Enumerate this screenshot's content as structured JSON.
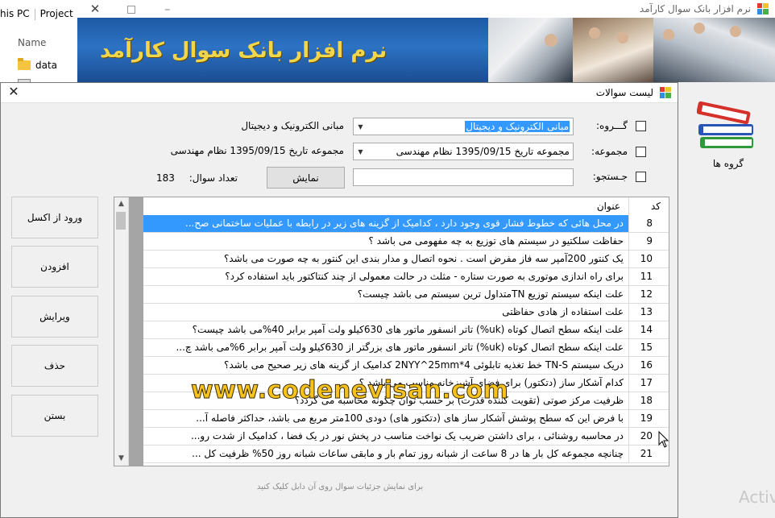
{
  "explorer": {
    "breadcrumb_1": "his PC",
    "breadcrumb_2": "Project",
    "column_name": "Name",
    "file_1": "data"
  },
  "main_window": {
    "title": "نرم افزار بانک سوال کارآمد",
    "banner_title": "نرم افزار بانک سوال کارآمد",
    "groups_label": "گروه ها",
    "activate_text": "Activ"
  },
  "dialog": {
    "title": "لیست سوالات",
    "group_label": "گـــروه:",
    "group_value": "مبانی الکترونیک و دیجیتال",
    "group_display": "مبانی الکترونیک و دیجیتال",
    "collection_label": "مجموعه:",
    "collection_value": "مجموعه تاریخ 1395/09/15 نظام مهندسی",
    "collection_display": "مجموعه تاریخ 1395/09/15 نظام مهندسی",
    "search_label": "جـستجو:",
    "search_value": "",
    "show_button": "نمایش",
    "count_label": "تعداد سوال:",
    "count_value": "183",
    "hint": "برای نمایش جزئیات سوال روی آن دابل کلیک کنید",
    "watermark": "www.codenevisan.com"
  },
  "sidebar": {
    "excel_import": "ورود از اکسل",
    "add": "افزودن",
    "edit": "ویرایش",
    "delete": "حذف",
    "close": "بستن"
  },
  "grid": {
    "columns": {
      "code": "کد",
      "title": "عنوان"
    },
    "selected_index": 0,
    "rows": [
      {
        "code": "8",
        "title": "در محل هائی که خطوط فشار قوی وجود دارد ، کدامیک از گزینه های زیر در رابطه با عملیات ساختمانی صح..."
      },
      {
        "code": "9",
        "title": "حفاظت سلکتیو  در سیستم های توزیع به چه مفهومی می باشد ؟"
      },
      {
        "code": "10",
        "title": "یک کنتور 200آمپر سه فاز  مفرض است . نحوه اتصال و مدار بندی این کنتور به چه صورت می باشد؟"
      },
      {
        "code": "11",
        "title": "برای راه اندازی موتوری به صورت ستاره - مثلث در حالت معمولی از چند کنتاکتور باید استفاده کرد؟"
      },
      {
        "code": "12",
        "title": "علت اینکه سیستم توزیع TNمتداول ترین سیستم می باشد چیست؟"
      },
      {
        "code": "13",
        "title": "علت استفاده از هادی  حفاظتی"
      },
      {
        "code": "14",
        "title": "علت اینکه سطح اتصال کوتاه (uk%) تاتر انسفور ماتور های 630کیلو ولت آمپر برابر 40%می باشد چیست؟"
      },
      {
        "code": "15",
        "title": "علت اینکه سطح اتصال کوتاه (uk%) تاتر انسفور ماتور های بزرگتر از 630کیلو ولت آمپر برابر 6%می باشد چ..."
      },
      {
        "code": "16",
        "title": "دریک سیستم TN-S خط تغذیه تابلوئی 4*2NYY^25mm    کدامیک از گزینه های زیر صحیح می باشد؟"
      },
      {
        "code": "17",
        "title": "کدام آشکار ساز (دتکتور) برای فضای آشپزخانه مناسب می باشد ؟"
      },
      {
        "code": "18",
        "title": "ظرفیت مرکز صوتی (تقویت کننده قدرت) بر حسب توان چگونه محاسبه می گردد؟"
      },
      {
        "code": "19",
        "title": "با فرض این که  سطح پوشش آشکار ساز های  (دتکتور های) دودی 100متر مربع می باشد، حداکثر فاصله آ..."
      },
      {
        "code": "20",
        "title": "در محاسبه روشنائی ،  برای داشتن ضریب یک نواخت مناسب در پخش نور در یک فضا ، کدامیک از شدت رو..."
      },
      {
        "code": "21",
        "title": "چنانچه مجموعه  کل بار ها در 8 ساعت  از شبانه روز تمام بار و مابقی  ساعات شبانه روز 50% ظرفیت کل ..."
      }
    ]
  },
  "colors": {
    "selection": "#3399ff",
    "banner": "#2d72c4",
    "banner_title": "#f2d64a",
    "watermark": "#f7c21b"
  },
  "icons": [
    "folder-icon",
    "close-icon",
    "maximize-icon",
    "minimize-icon",
    "app-icon",
    "books-icon",
    "chevron-down-icon",
    "scroll-up-icon",
    "scroll-down-icon",
    "mouse-cursor-icon"
  ]
}
